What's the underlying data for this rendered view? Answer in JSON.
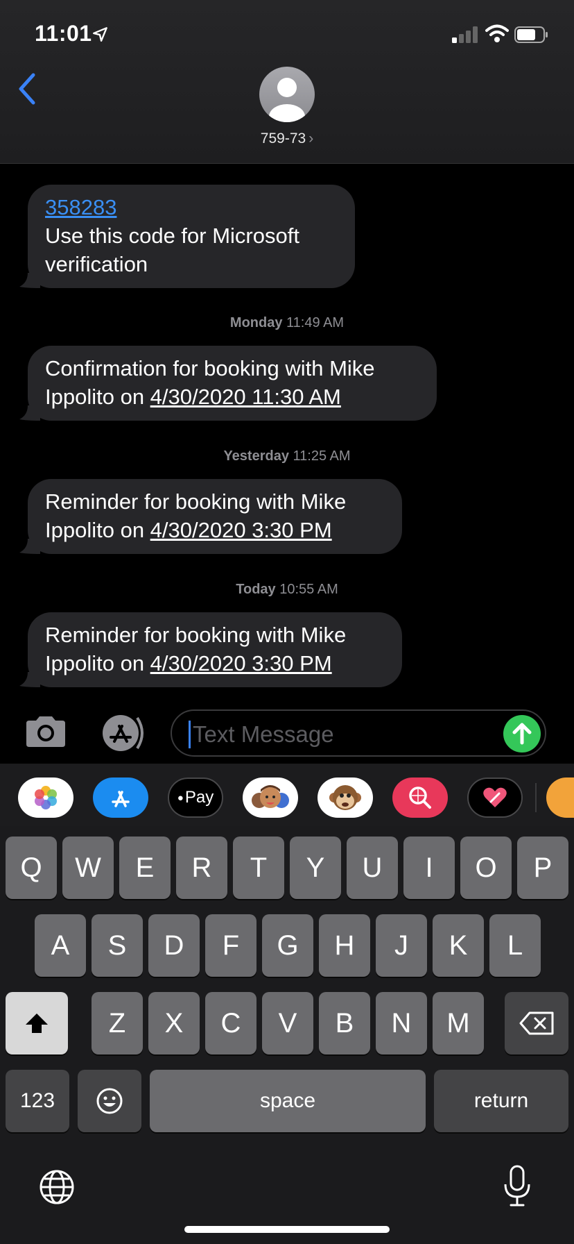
{
  "status_bar": {
    "time": "11:01"
  },
  "header": {
    "contact": "759-73",
    "chevron": "›"
  },
  "messages": {
    "partial_text": "verification",
    "m1": {
      "code": "358283",
      "line2": "Use this code for Microsoft",
      "line3": "verification"
    },
    "t1": {
      "day": "Monday",
      "time": "11:49 AM"
    },
    "m2": {
      "line1": "Confirmation for booking with Mike",
      "prefix2": "Ippolito on ",
      "link": "4/30/2020 11:30 AM"
    },
    "t2": {
      "day": "Yesterday",
      "time": "11:25 AM"
    },
    "m3": {
      "line1": "Reminder for booking with Mike",
      "prefix2": "Ippolito on ",
      "link": "4/30/2020 3:30 PM"
    },
    "t3": {
      "day": "Today",
      "time": "10:55 AM"
    },
    "m4": {
      "line1": "Reminder for booking with Mike",
      "prefix2": "Ippolito on ",
      "link": "4/30/2020 3:30 PM"
    }
  },
  "composer": {
    "placeholder": "Text Message"
  },
  "drawer": {
    "apple_pay": "Pay",
    "icons": [
      "photos-icon",
      "app-store-icon",
      "apple-pay-icon",
      "memoji-icon",
      "monkey-animoji-icon",
      "search-images-icon",
      "digital-touch-icon",
      "more-apps-icon"
    ]
  },
  "keyboard": {
    "row1": [
      "Q",
      "W",
      "E",
      "R",
      "T",
      "Y",
      "U",
      "I",
      "O",
      "P"
    ],
    "row2": [
      "A",
      "S",
      "D",
      "F",
      "G",
      "H",
      "J",
      "K",
      "L"
    ],
    "row3": [
      "Z",
      "X",
      "C",
      "V",
      "B",
      "N",
      "M"
    ],
    "numbers": "123",
    "space": "space",
    "return": "return"
  },
  "colors": {
    "link": "#3a8ff4",
    "send": "#34c759",
    "bubble": "#262629"
  }
}
